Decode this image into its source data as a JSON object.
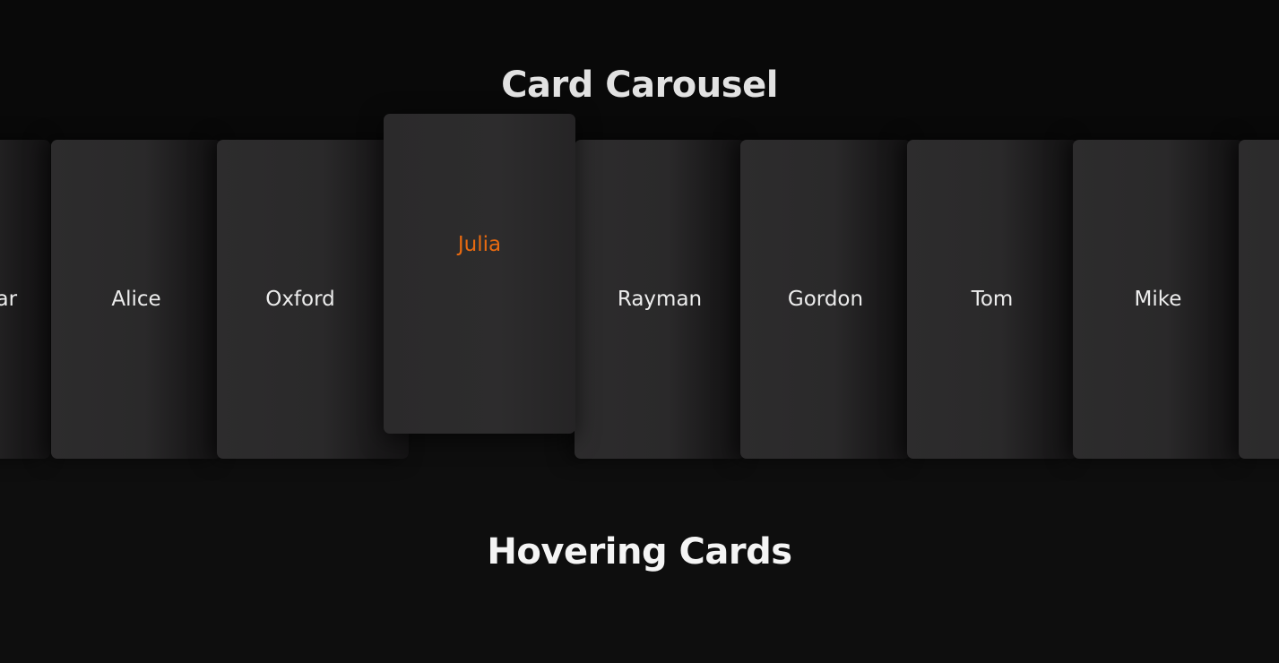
{
  "sections": {
    "carousel_title": "Card Carousel",
    "hover_title": "Hovering Cards"
  },
  "cards": [
    {
      "label": "dar"
    },
    {
      "label": "Alice"
    },
    {
      "label": "Oxford"
    },
    {
      "label": "Julia",
      "active": true
    },
    {
      "label": "Rayman"
    },
    {
      "label": "Gordon"
    },
    {
      "label": "Tom"
    },
    {
      "label": "Mike"
    },
    {
      "label": ""
    }
  ],
  "colors": {
    "background": "#0e0e0e",
    "card": "#2d2c2d",
    "active_label": "#e86a10",
    "label": "#ededed"
  }
}
